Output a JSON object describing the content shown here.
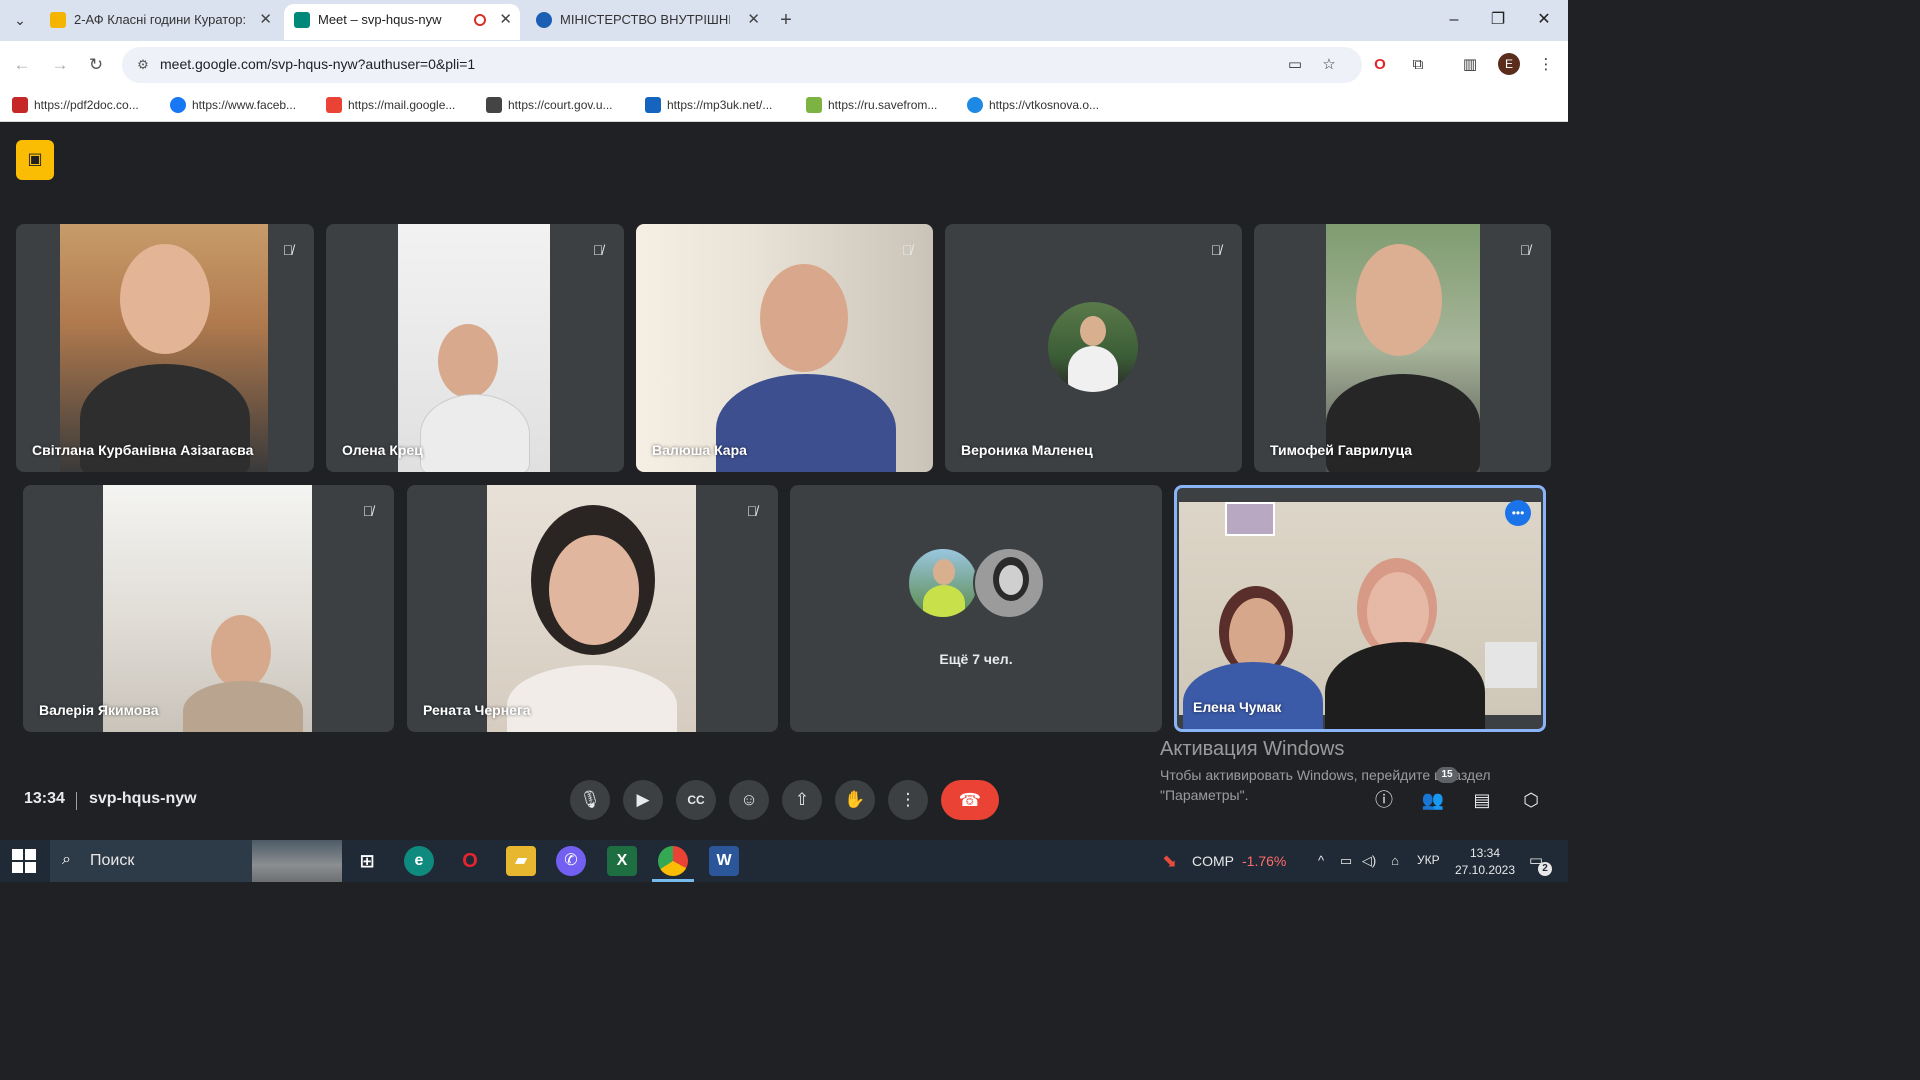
{
  "browser": {
    "tabs": [
      {
        "title": "2-АФ Класні години Куратор:",
        "favicon_color": "#f4b400"
      },
      {
        "title": "Meet – svp-hqus-nyw",
        "favicon_color": "#00897b"
      },
      {
        "title": "МІНІСТЕРСТВО ВНУТРІШНІХ С",
        "favicon_color": "#1a5fb4"
      }
    ],
    "url": "meet.google.com/svp-hqus-nyw?authuser=0&pli=1",
    "profile_initial": "E",
    "bookmarks": [
      {
        "label": "https://pdf2doc.co...",
        "color": "#c62828"
      },
      {
        "label": "https://www.faceb...",
        "color": "#1877f2"
      },
      {
        "label": "https://mail.google...",
        "color": "#ea4335"
      },
      {
        "label": "https://court.gov.u...",
        "color": "#444444"
      },
      {
        "label": "https://mp3uk.net/...",
        "color": "#1565c0"
      },
      {
        "label": "https://ru.savefrom...",
        "color": "#7cb342"
      },
      {
        "label": "https://vtkosnova.o...",
        "color": "#1e88e5"
      }
    ]
  },
  "meet": {
    "participants_row1": [
      {
        "name": "Світлана Курбанівна Азізагаєва"
      },
      {
        "name": "Олена Крец"
      },
      {
        "name": "Валюша Кара"
      },
      {
        "name": "Вероника Маленец"
      },
      {
        "name": "Тимофей Гаврилуца"
      }
    ],
    "participants_row2": [
      {
        "name": "Валерія Якимова"
      },
      {
        "name": "Рената Чернега"
      },
      {
        "name": "Ещё 7 чел."
      },
      {
        "name": "Елена Чумак"
      }
    ],
    "clock": "13:34",
    "meeting_code": "svp-hqus-nyw",
    "participant_count": "15",
    "accent": "#8ab4f8",
    "hangup_color": "#ea4335"
  },
  "windows_activation": {
    "title": "Активация Windows",
    "text": "Чтобы активировать Windows, перейдите в раздел \"Параметры\"."
  },
  "taskbar": {
    "search_placeholder": "Поиск",
    "stock_name": "COMP",
    "stock_change": "-1.76%",
    "language": "УКР",
    "time": "13:34",
    "date": "27.10.2023",
    "notification_count": "2"
  }
}
